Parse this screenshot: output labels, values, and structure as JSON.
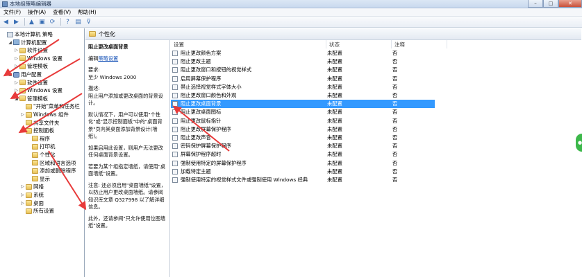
{
  "window": {
    "title": "本地组策略编辑器",
    "min": "–",
    "max": "□",
    "close": "✕"
  },
  "menu": [
    "文件(F)",
    "操作(A)",
    "查看(V)",
    "帮助(H)"
  ],
  "toolbar": {
    "back": "◀",
    "forward": "▶",
    "up": "▲",
    "show": "▣",
    "refresh": "⟳",
    "help": "?",
    "properties": "▤",
    "filter": "⊽"
  },
  "tree": [
    {
      "label": "本地计算机 策略",
      "exp": "",
      "icon": "policy",
      "indent": 0
    },
    {
      "label": "计算机配置",
      "exp": "◢",
      "icon": "computer",
      "indent": 1
    },
    {
      "label": "软件设置",
      "exp": "▷",
      "icon": "folder",
      "indent": 2
    },
    {
      "label": "Windows 设置",
      "exp": "▷",
      "icon": "folder",
      "indent": 2
    },
    {
      "label": "管理模板",
      "exp": "▷",
      "icon": "folder",
      "indent": 2
    },
    {
      "label": "用户配置",
      "exp": "◢",
      "icon": "user",
      "indent": 1
    },
    {
      "label": "软件设置",
      "exp": "▷",
      "icon": "folder",
      "indent": 2
    },
    {
      "label": "Windows 设置",
      "exp": "▷",
      "icon": "folder",
      "indent": 2
    },
    {
      "label": "管理模板",
      "exp": "◢",
      "icon": "folder",
      "indent": 2
    },
    {
      "label": "\"开始\"菜单和任务栏",
      "exp": "",
      "icon": "folder",
      "indent": 3
    },
    {
      "label": "Windows 组件",
      "exp": "▷",
      "icon": "folder",
      "indent": 3
    },
    {
      "label": "共享文件夹",
      "exp": "",
      "icon": "folder",
      "indent": 3
    },
    {
      "label": "控制面板",
      "exp": "◢",
      "icon": "folder",
      "indent": 3
    },
    {
      "label": "程序",
      "exp": "",
      "icon": "folder",
      "indent": 4
    },
    {
      "label": "打印机",
      "exp": "",
      "icon": "folder",
      "indent": 4
    },
    {
      "label": "个性化",
      "exp": "",
      "icon": "folder",
      "indent": 4
    },
    {
      "label": "区域和语言选项",
      "exp": "",
      "icon": "folder",
      "indent": 4
    },
    {
      "label": "添加或删除程序",
      "exp": "",
      "icon": "folder",
      "indent": 4
    },
    {
      "label": "显示",
      "exp": "",
      "icon": "folder",
      "indent": 4
    },
    {
      "label": "网络",
      "exp": "▷",
      "icon": "folder",
      "indent": 3
    },
    {
      "label": "系统",
      "exp": "▷",
      "icon": "folder",
      "indent": 3
    },
    {
      "label": "桌面",
      "exp": "▷",
      "icon": "folder",
      "indent": 3
    },
    {
      "label": "所有设置",
      "exp": "",
      "icon": "folder",
      "indent": 3
    }
  ],
  "center": {
    "header": "个性化",
    "title": "阻止更改桌面背景",
    "edit_prefix": "编辑",
    "edit_link": "策略设置",
    "req_label": "要求:",
    "req_value": "至少 Windows 2000",
    "desc_label": "描述:",
    "p1": "阻止用户添加或更改桌面的背景设计。",
    "p2": "默认情况下，用户可以使用\"个性化\"或\"显示控制面板\"中的\"桌面背景\"页向其桌面添加背景设计(墙纸)。",
    "p3": "如果启用此设置，则用户无法更改任何桌面背景设置。",
    "p4": "若要为某个组指定墙纸，请使用\"桌面墙纸\"设置。",
    "p5": "注意: 还必须启用\"桌面墙纸\"设置，以防止用户更改桌面墙纸。请参阅知识库文章 Q327998 以了解详细信息。",
    "p6": "此外，还请参阅\"只允许使用位图墙纸\"设置。"
  },
  "list": {
    "headers": {
      "setting": "设置",
      "state": "状态",
      "note": "注释"
    },
    "rows": [
      {
        "name": "阻止更改颜色方案",
        "state": "未配置",
        "note": "否"
      },
      {
        "name": "阻止更改主题",
        "state": "未配置",
        "note": "否"
      },
      {
        "name": "阻止更改窗口和按钮的视觉样式",
        "state": "未配置",
        "note": "否"
      },
      {
        "name": "启用屏幕保护程序",
        "state": "未配置",
        "note": "否"
      },
      {
        "name": "禁止选择视觉样式字体大小",
        "state": "未配置",
        "note": "否"
      },
      {
        "name": "阻止更改窗口颜色和外观",
        "state": "未配置",
        "note": "否"
      },
      {
        "name": "阻止更改桌面背景",
        "state": "未配置",
        "note": "否"
      },
      {
        "name": "阻止更改桌面图标",
        "state": "未配置",
        "note": "否"
      },
      {
        "name": "阻止更改鼠标指针",
        "state": "未配置",
        "note": "否"
      },
      {
        "name": "阻止更改屏幕保护程序",
        "state": "未配置",
        "note": "否"
      },
      {
        "name": "阻止更改声音",
        "state": "未配置",
        "note": "否"
      },
      {
        "name": "密码保护屏幕保护程序",
        "state": "未配置",
        "note": "否"
      },
      {
        "name": "屏幕保护程序超时",
        "state": "未配置",
        "note": "否"
      },
      {
        "name": "强制使用特定的屏幕保护程序",
        "state": "未配置",
        "note": "否"
      },
      {
        "name": "加载特定主题",
        "state": "未配置",
        "note": "否"
      },
      {
        "name": "强制使用特定的视觉样式文件或强制使用 Windows 经典",
        "state": "未配置",
        "note": "否"
      }
    ],
    "selected_index": 6
  },
  "colors": {
    "selection": "#3399ff",
    "arrow": "#e83a3a",
    "link": "#1a55b8"
  }
}
